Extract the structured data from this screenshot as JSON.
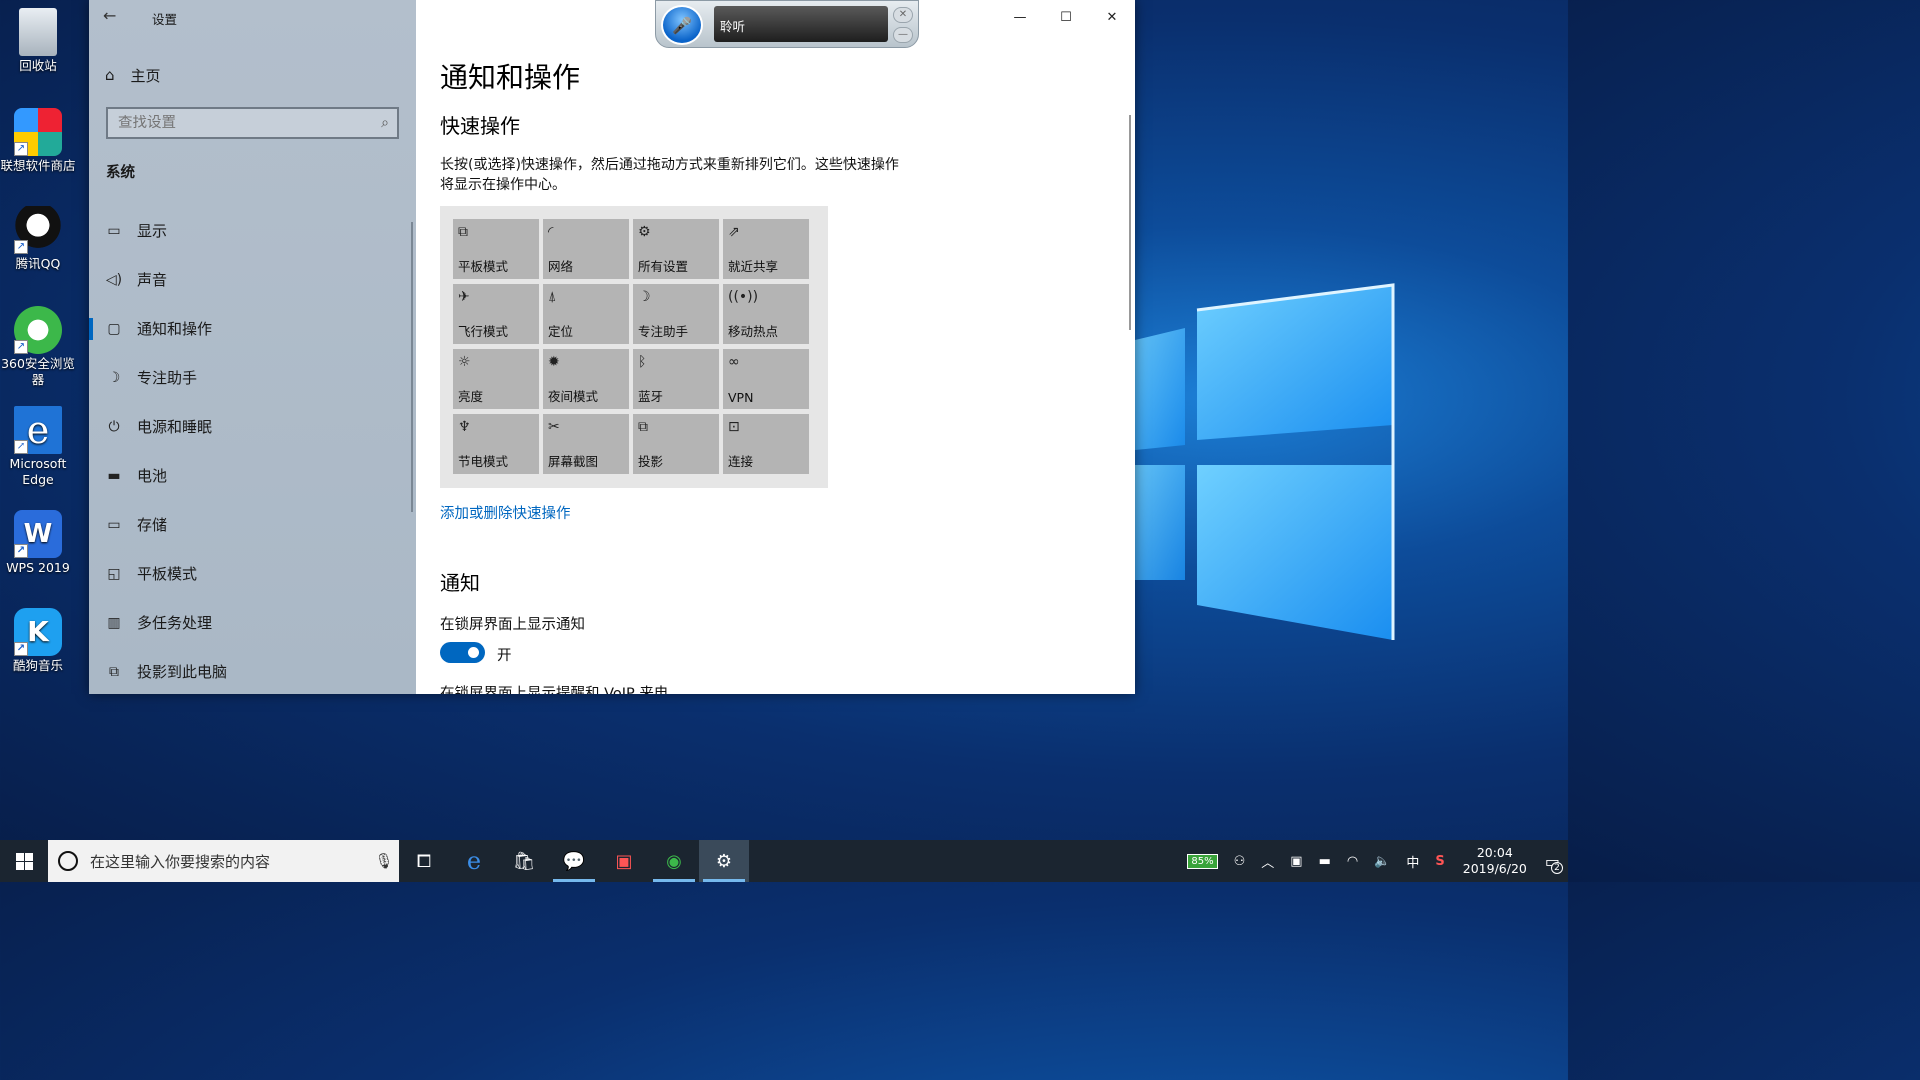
{
  "desktop": {
    "icons": [
      {
        "label": "回收站",
        "icon": "recycle-bin-icon"
      },
      {
        "label": "联想软件商店",
        "icon": "lenovo-store-icon"
      },
      {
        "label": "腾讯QQ",
        "icon": "qq-icon"
      },
      {
        "label": "360安全浏览器",
        "icon": "360-browser-icon"
      },
      {
        "label": "Microsoft Edge",
        "icon": "edge-icon"
      },
      {
        "label": "WPS 2019",
        "icon": "wps-icon"
      },
      {
        "label": "酷狗音乐",
        "icon": "kugou-icon"
      }
    ]
  },
  "voice_widget": {
    "status": "聆听"
  },
  "settings": {
    "app_title": "设置",
    "sidebar": {
      "home": "主页",
      "search_placeholder": "查找设置",
      "section": "系统",
      "items": [
        {
          "label": "显示",
          "icon": "monitor-icon"
        },
        {
          "label": "声音",
          "icon": "speaker-icon"
        },
        {
          "label": "通知和操作",
          "icon": "notification-icon",
          "active": true
        },
        {
          "label": "专注助手",
          "icon": "moon-icon"
        },
        {
          "label": "电源和睡眠",
          "icon": "power-icon"
        },
        {
          "label": "电池",
          "icon": "battery-icon"
        },
        {
          "label": "存储",
          "icon": "storage-icon"
        },
        {
          "label": "平板模式",
          "icon": "tablet-icon"
        },
        {
          "label": "多任务处理",
          "icon": "multitask-icon"
        },
        {
          "label": "投影到此电脑",
          "icon": "project-icon"
        }
      ]
    },
    "page_title": "通知和操作",
    "quick_actions": {
      "heading": "快速操作",
      "description": "长按(或选择)快速操作，然后通过拖动方式来重新排列它们。这些快速操作将显示在操作中心。",
      "tiles": [
        {
          "label": "平板模式",
          "icon": "tablet-mode-icon"
        },
        {
          "label": "网络",
          "icon": "network-icon"
        },
        {
          "label": "所有设置",
          "icon": "gear-icon"
        },
        {
          "label": "就近共享",
          "icon": "share-icon"
        },
        {
          "label": "飞行模式",
          "icon": "airplane-icon"
        },
        {
          "label": "定位",
          "icon": "location-icon"
        },
        {
          "label": "专注助手",
          "icon": "moon-icon"
        },
        {
          "label": "移动热点",
          "icon": "hotspot-icon"
        },
        {
          "label": "亮度",
          "icon": "brightness-icon"
        },
        {
          "label": "夜间模式",
          "icon": "night-light-icon"
        },
        {
          "label": "蓝牙",
          "icon": "bluetooth-icon"
        },
        {
          "label": "VPN",
          "icon": "vpn-icon"
        },
        {
          "label": "节电模式",
          "icon": "battery-saver-icon"
        },
        {
          "label": "屏幕截图",
          "icon": "screen-snip-icon"
        },
        {
          "label": "投影",
          "icon": "project-icon"
        },
        {
          "label": "连接",
          "icon": "connect-icon"
        }
      ],
      "link": "添加或删除快速操作"
    },
    "notifications": {
      "heading": "通知",
      "lockscreen_label": "在锁屏界面上显示通知",
      "lockscreen_toggle": "开",
      "next_label": "在锁屏界面上显示提醒和 VoIP 来电"
    }
  },
  "taskbar": {
    "search_placeholder": "在这里输入你要搜索的内容",
    "apps": [
      "task-view-icon",
      "edge-icon",
      "store-icon",
      "wechat-icon",
      "lenovo-store-icon",
      "360-browser-icon",
      "settings-gear-icon"
    ],
    "tray": {
      "battery_percent": "85%",
      "ime": "中",
      "time": "20:04",
      "date": "2019/6/20",
      "notification_count": "2"
    }
  }
}
